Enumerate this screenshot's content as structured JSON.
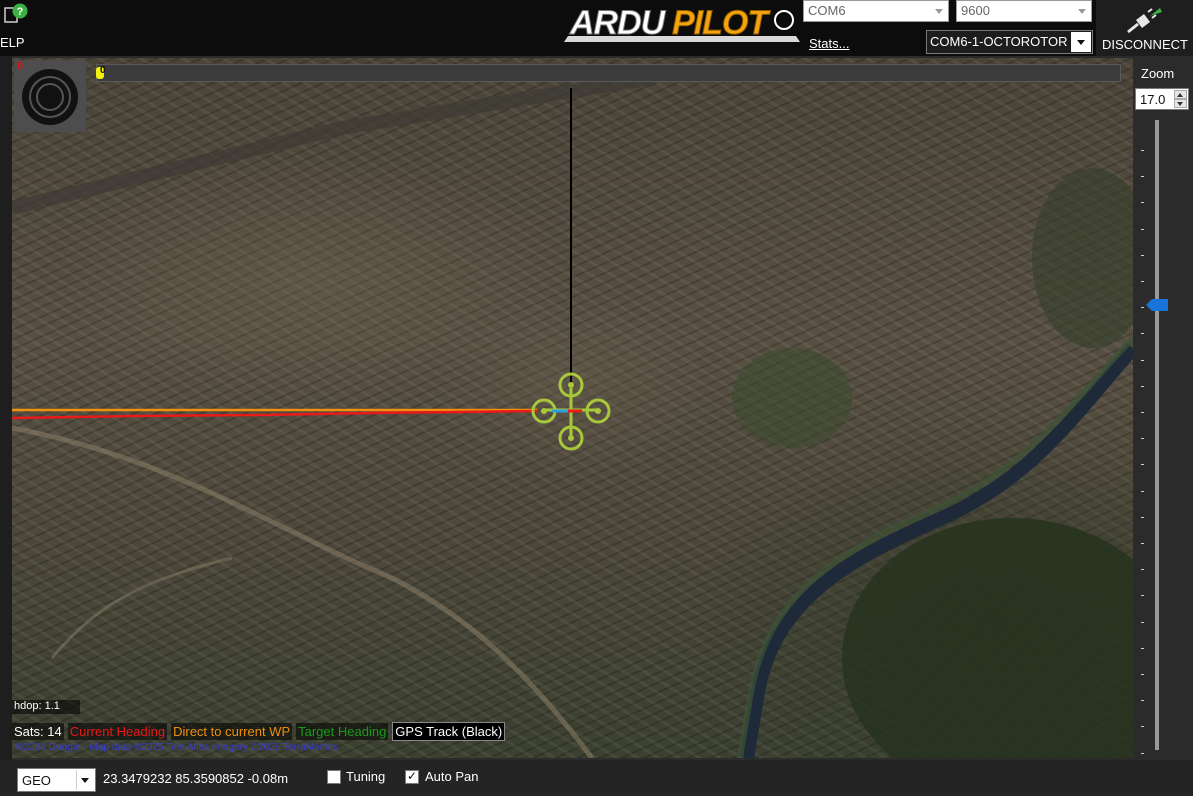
{
  "header": {
    "help_label": "ELP",
    "logo_text": "ARDUPILOT",
    "com_port": "COM6",
    "baud_rate": "9600",
    "stats_link": "Stats...",
    "vehicle": "COM6-1-OCTOROTOR",
    "disconnect_label": "DISCONNECT"
  },
  "map": {
    "hud_count": "0",
    "progress_value": "0",
    "hdop": "hdop: 1.1",
    "sats": "Sats: 14",
    "legend": {
      "current_heading": "Current Heading",
      "direct_wp": "Direct to current WP",
      "target_heading": "Target Heading",
      "gps_track": "GPS Track (Black)"
    },
    "attribution": "©2024 Google - Map data ©2025 Tele Atlas  Imagery ©2025 TerraMetrics",
    "colors": {
      "current_heading": "#e81a1a",
      "direct_wp": "#f0900c",
      "target_heading": "#1a9a1a",
      "gps_track": "#000000",
      "drone": "#a8c83a"
    }
  },
  "zoom": {
    "label": "Zoom",
    "value": "17.0"
  },
  "footer": {
    "coord_system": "GEO",
    "coords": "23.3479232 85.3590852   -0.08m",
    "tuning_label": "Tuning",
    "tuning_checked": false,
    "autopan_label": "Auto Pan",
    "autopan_checked": true
  }
}
